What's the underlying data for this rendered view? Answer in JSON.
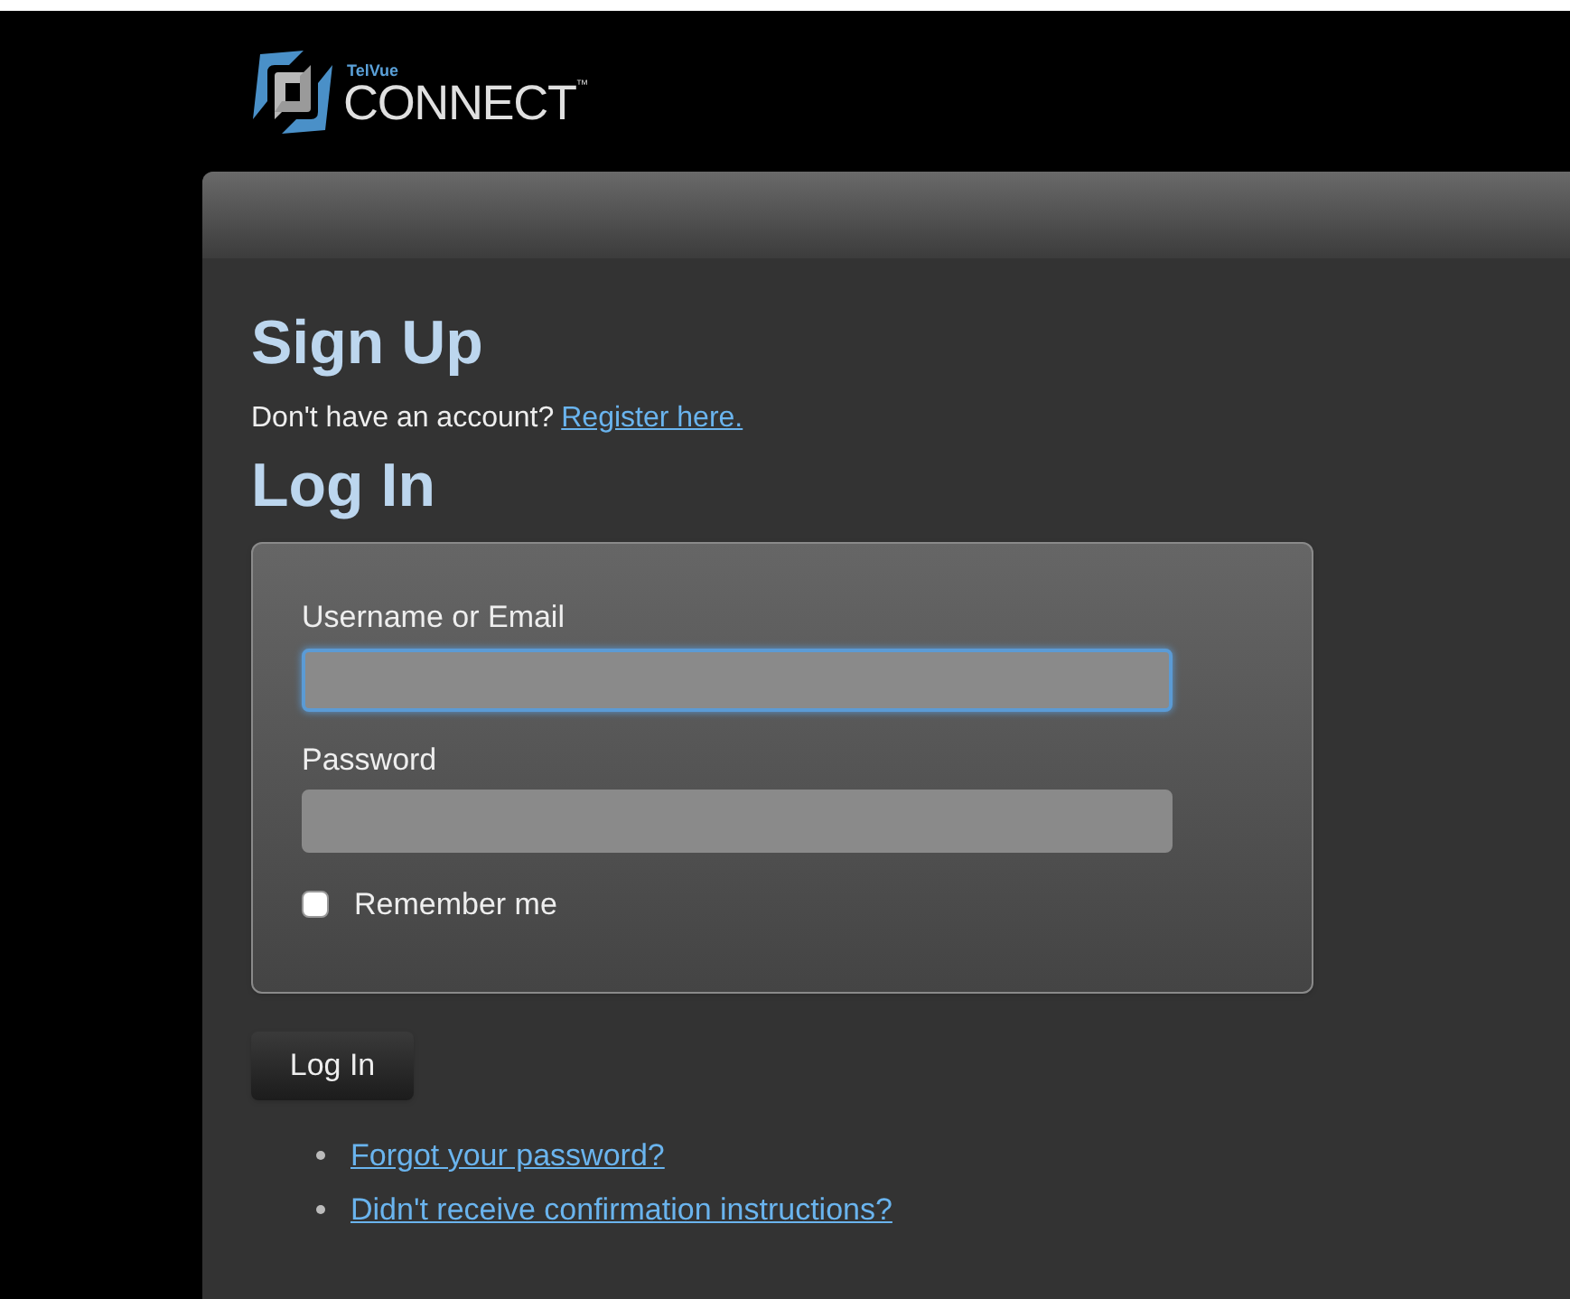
{
  "logo": {
    "brand_small": "TelVue",
    "brand": "CONNECT",
    "mark": "™"
  },
  "signup": {
    "heading": "Sign Up",
    "prompt": "Don't have an account?",
    "link": "Register here."
  },
  "login": {
    "heading": "Log In",
    "fields": [
      {
        "label": "Username or Email",
        "focused": true
      },
      {
        "label": "Password",
        "focused": false
      }
    ],
    "remember": {
      "label": "Remember me",
      "checked": false
    },
    "button": "Log In"
  },
  "links": [
    "Forgot your password?",
    "Didn't receive confirmation instructions?"
  ]
}
